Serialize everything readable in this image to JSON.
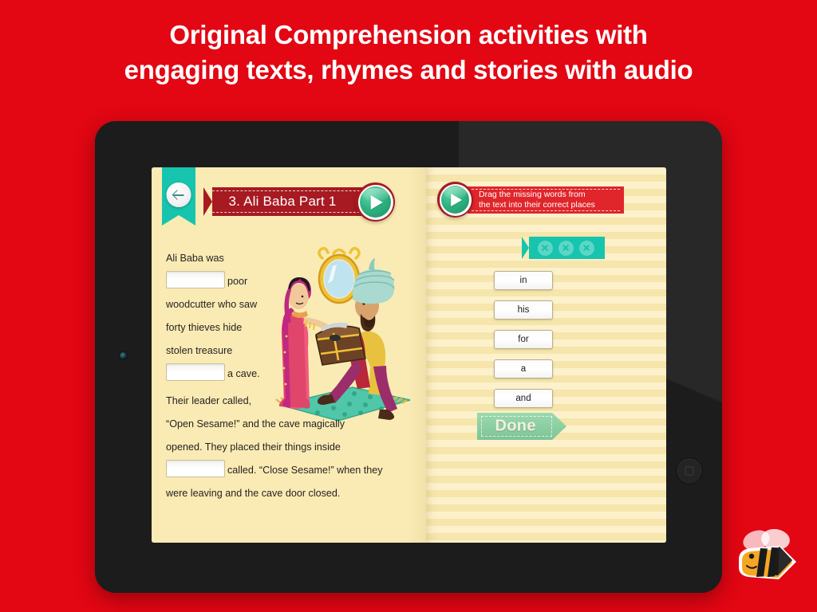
{
  "headline": {
    "line1": "Original Comprehension activities with",
    "line2": "engaging texts, rhymes and stories with audio"
  },
  "colors": {
    "background_red": "#E30613",
    "page_cream": "#FAEBB4",
    "ribbon_dark_red": "#A71A22",
    "ribbon_red": "#E0262B",
    "teal": "#17C4AE",
    "play_green": "#2fb583",
    "done_green": "#8ccfa2",
    "tablet_black": "#1c1c1c"
  },
  "tablet": {
    "camera_name": "front-camera",
    "home_button_name": "home-button"
  },
  "app": {
    "back_button": {
      "icon": "arrow-left-icon",
      "label": "Back"
    },
    "left_page": {
      "title": "3. Ali Baba Part 1",
      "play_label": "Play audio",
      "paragraphs": [
        {
          "segments": [
            {
              "type": "text",
              "value": "Ali Baba was"
            },
            {
              "type": "blank",
              "value": ""
            },
            {
              "type": "text",
              "value": "poor woodcutter who saw forty thieves hide stolen treasure"
            },
            {
              "type": "blank",
              "value": ""
            },
            {
              "type": "text",
              "value": "a cave."
            }
          ]
        },
        {
          "segments": [
            {
              "type": "text",
              "value": "Their leader called, “Open Sesame!” and the cave magically opened. They placed their things inside"
            },
            {
              "type": "blank",
              "value": ""
            },
            {
              "type": "text",
              "value": "called. “Close Sesame!” when they were leaving and the cave door closed."
            }
          ]
        }
      ],
      "paragraph1_text_a": "Ali Baba was",
      "paragraph1_text_b": "poor",
      "paragraph1_text_c": "woodcutter who",
      "paragraph1_text_d": "saw forty thieves",
      "paragraph1_text_e": "hide stolen",
      "paragraph1_text_f": "treasure",
      "paragraph1_text_g": "a cave.",
      "paragraph2_text_a": "Their leader called,",
      "paragraph2_text_b": "“Open Sesame!” and the cave magically",
      "paragraph2_text_c": "opened. They placed their things inside",
      "paragraph2_text_d": "called. “Close Sesame!” when they",
      "paragraph2_text_e": "were leaving and the cave door closed.",
      "illustration_alt": "Ali Baba story illustration: woman in sari and man in turban with treasure chest on carpet"
    },
    "right_page": {
      "play_label": "Play instructions",
      "instruction_line1": "Drag the missing words from",
      "instruction_line2": "the text into their correct places",
      "lives": [
        {
          "icon": "circle-x-icon"
        },
        {
          "icon": "circle-x-icon"
        },
        {
          "icon": "circle-x-icon"
        }
      ],
      "word_chips": [
        "in",
        "his",
        "for",
        "a",
        "and"
      ],
      "done_label": "Done"
    }
  },
  "mascot": {
    "name": "bee-pencil-mascot"
  }
}
